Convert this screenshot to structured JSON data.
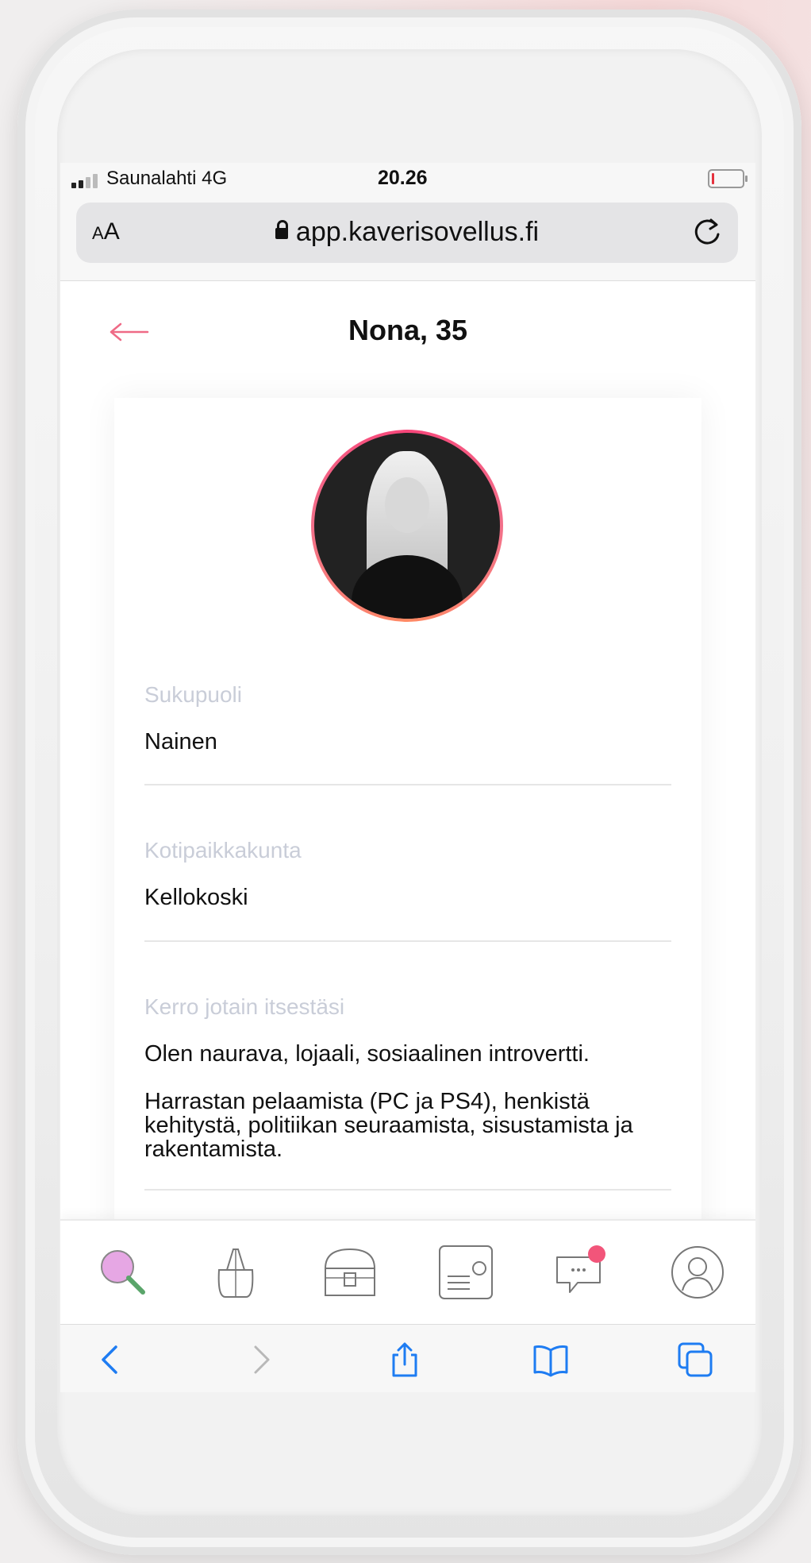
{
  "status_bar": {
    "carrier": "Saunalahti  4G",
    "time": "20.26"
  },
  "browser": {
    "text_size_label_small": "A",
    "text_size_label_large": "A",
    "url": "app.kaverisovellus.fi"
  },
  "page": {
    "title": "Nona, 35"
  },
  "profile": {
    "fields": [
      {
        "label": "Sukupuoli",
        "value": "Nainen"
      },
      {
        "label": "Kotipaikkakunta",
        "value": "Kellokoski"
      },
      {
        "label": "Kerro jotain itsestäsi",
        "paragraphs": [
          "Olen naurava, lojaali, sosiaalinen introvertti.",
          "Harrastan pelaamista (PC ja PS4), henkistä kehitystä, politiikan seuraamista, sisustamista ja rakentamista."
        ]
      }
    ]
  },
  "app_nav": {
    "items": [
      "search-icon",
      "bag-icon",
      "treasure-chest-icon",
      "profile-card-icon",
      "chat-icon",
      "user-icon"
    ],
    "active": "search-icon",
    "badge_color": "#f2557a"
  },
  "safari_toolbar": {
    "items": [
      "back-icon",
      "forward-icon",
      "share-icon",
      "bookmarks-icon",
      "tabs-icon"
    ]
  },
  "colors": {
    "accent": "#f2557a",
    "ios_blue": "#1e7cf2",
    "label_gray": "#c9cdd8"
  }
}
